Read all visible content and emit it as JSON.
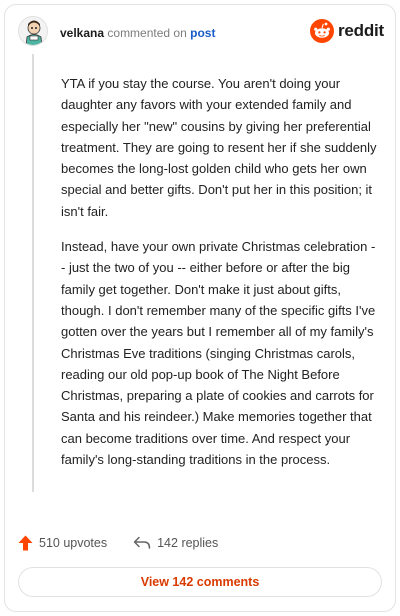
{
  "header": {
    "username": "velkana",
    "verb": "commented on",
    "post_link": "post",
    "brand": "reddit",
    "brand_color": "#ff4500",
    "avatar_icon": "avatar-icon"
  },
  "comment": {
    "paragraphs": [
      "YTA if you stay the course. You aren't doing your daughter any favors with your extended family and especially her \"new\" cousins by giving her preferential treatment. They are going to resent her if she suddenly becomes the long-lost golden child who gets her own special and better gifts. Don't put her in this position; it isn't fair.",
      "Instead, have your own private Christmas celebration -- just the two of you -- either before or after the big family get together. Don't make it just about gifts, though. I don't remember many of the specific gifts I've gotten over the years but I remember all of my family's Christmas Eve traditions (singing Christmas carols, reading our old pop-up book of The Night Before Christmas, preparing a plate of cookies and carrots for Santa and his reindeer.) Make memories together that can become traditions over time. And respect your family's long-standing traditions in the process."
    ]
  },
  "stats": {
    "upvotes": "510 upvotes",
    "replies": "142 replies",
    "upvote_icon": "upvote-arrow-icon",
    "reply_icon": "reply-arrow-icon"
  },
  "view_button": {
    "label": "View 142 comments",
    "color": "#d93a00"
  }
}
